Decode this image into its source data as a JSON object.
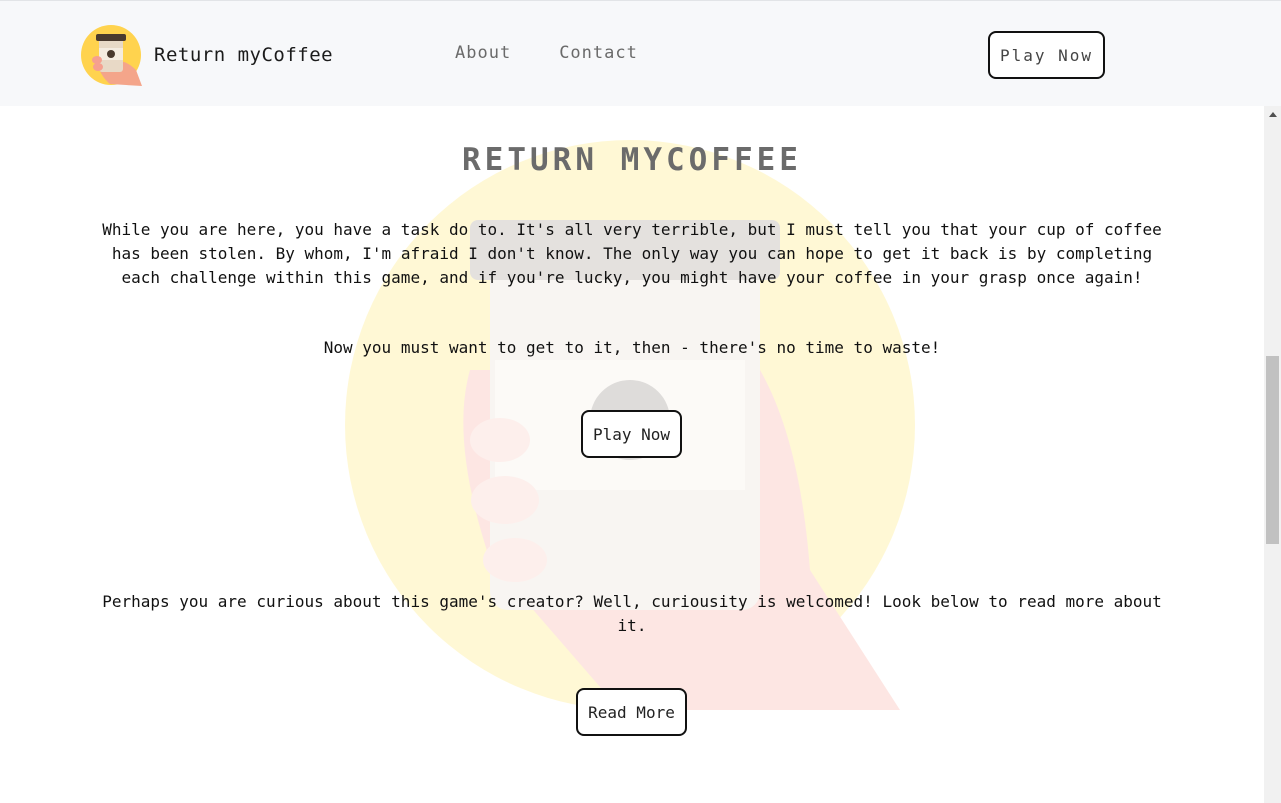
{
  "navbar": {
    "brand_name": "Return myCoffee",
    "links": [
      "About",
      "Contact"
    ],
    "play_label": "Play Now"
  },
  "main": {
    "title": "RETURN MYCOFFEE",
    "intro": "While you are here, you have a task do to. It's all very terrible, but I must tell you that your cup of coffee has been stolen. By whom, I'm afraid I don't know. The only way you can hope to get it back is by completing each challenge within this game, and if you're lucky, you might have your coffee in your grasp once again!",
    "call_to_action": "Now you must want to get to it, then - there's no time to waste!",
    "play_label": "Play Now",
    "creator_text": "Perhaps you are curious about this game's creator? Well, curiousity is welcomed! Look below to read more about it.",
    "read_more_label": "Read More"
  },
  "colors": {
    "nav_background": "#f7f8fa",
    "title": "#6b6b6b",
    "logo_yellow": "#ffd34e",
    "hand": "#f4a58a"
  },
  "icons": {
    "logo": "coffee-cup-in-hand-icon",
    "scroll_up": "triangle-up-icon"
  }
}
